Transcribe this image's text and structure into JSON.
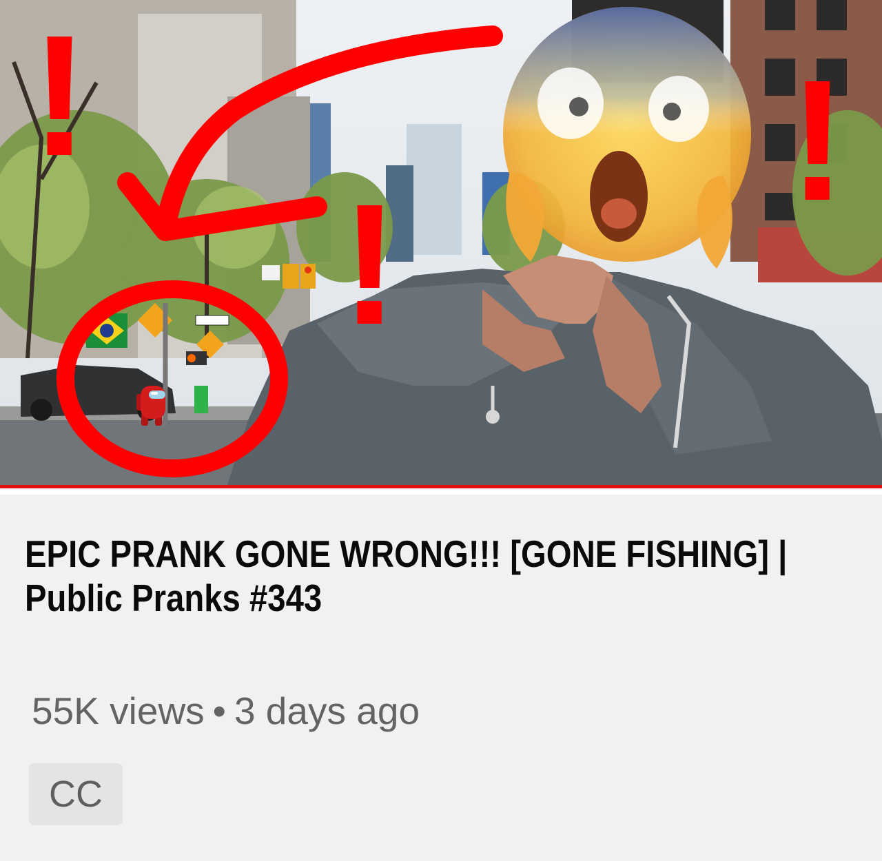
{
  "video": {
    "title": "EPIC PRANK GONE WRONG!!! [GONE FISHING] | Public Pranks #343",
    "views": "55K views",
    "separator": "•",
    "age": "3 days ago",
    "badge": "CC",
    "watch_progress": 1.0
  },
  "thumbnail": {
    "exclamations": [
      "!",
      "!",
      "!"
    ],
    "accent_color": "#ff0000",
    "icons": [
      "screaming-face-emoji",
      "crewmate-character",
      "red-arrow",
      "red-circle"
    ]
  },
  "colors": {
    "background": "#f1f1f1",
    "title": "#0a0a0a",
    "meta": "#636363",
    "badge_bg": "#e4e4e4",
    "progress": "#e01010"
  }
}
